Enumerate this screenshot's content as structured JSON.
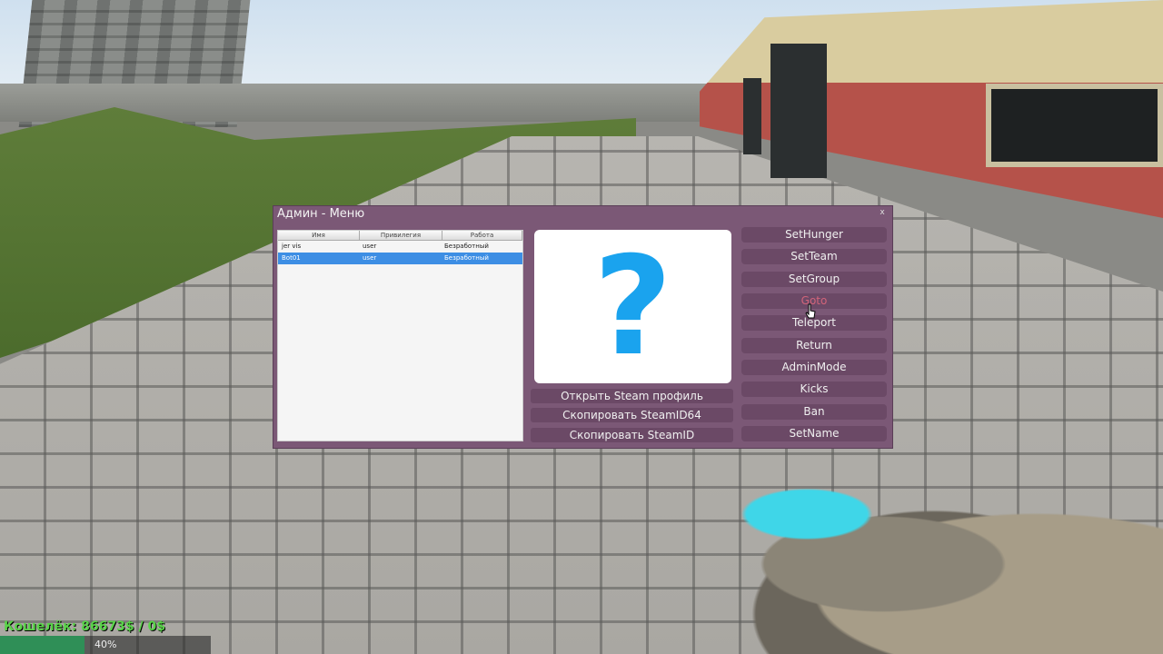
{
  "window": {
    "title": "Админ - Меню",
    "close_glyph": "x"
  },
  "players": {
    "columns": [
      "Имя",
      "Привилегия",
      "Работа"
    ],
    "rows": [
      {
        "name": "jer vis",
        "rank": "user",
        "job": "Безработный",
        "selected": false
      },
      {
        "name": "Bot01",
        "rank": "user",
        "job": "Безработный",
        "selected": true
      }
    ]
  },
  "avatar": {
    "glyph": "?",
    "color": "#1aa3ee"
  },
  "profile_buttons": [
    "Открыть Steam профиль",
    "Скопировать SteamID64",
    "Скопировать SteamID"
  ],
  "actions": [
    "SetHunger",
    "SetTeam",
    "SetGroup",
    "Goto",
    "Teleport",
    "Return",
    "AdminMode",
    "Kicks",
    "Ban",
    "SetName"
  ],
  "hovered_action": "Goto",
  "hud": {
    "wallet": "Кошелёк: 86673$ / 0$",
    "progress_percent": 40,
    "progress_label": "40%"
  },
  "colors": {
    "window_bg": "#7b5876",
    "button_bg": "#6b4966",
    "selection": "#3d8ee4",
    "hover_text": "#d2647a",
    "wallet_text": "#5ad34a"
  }
}
